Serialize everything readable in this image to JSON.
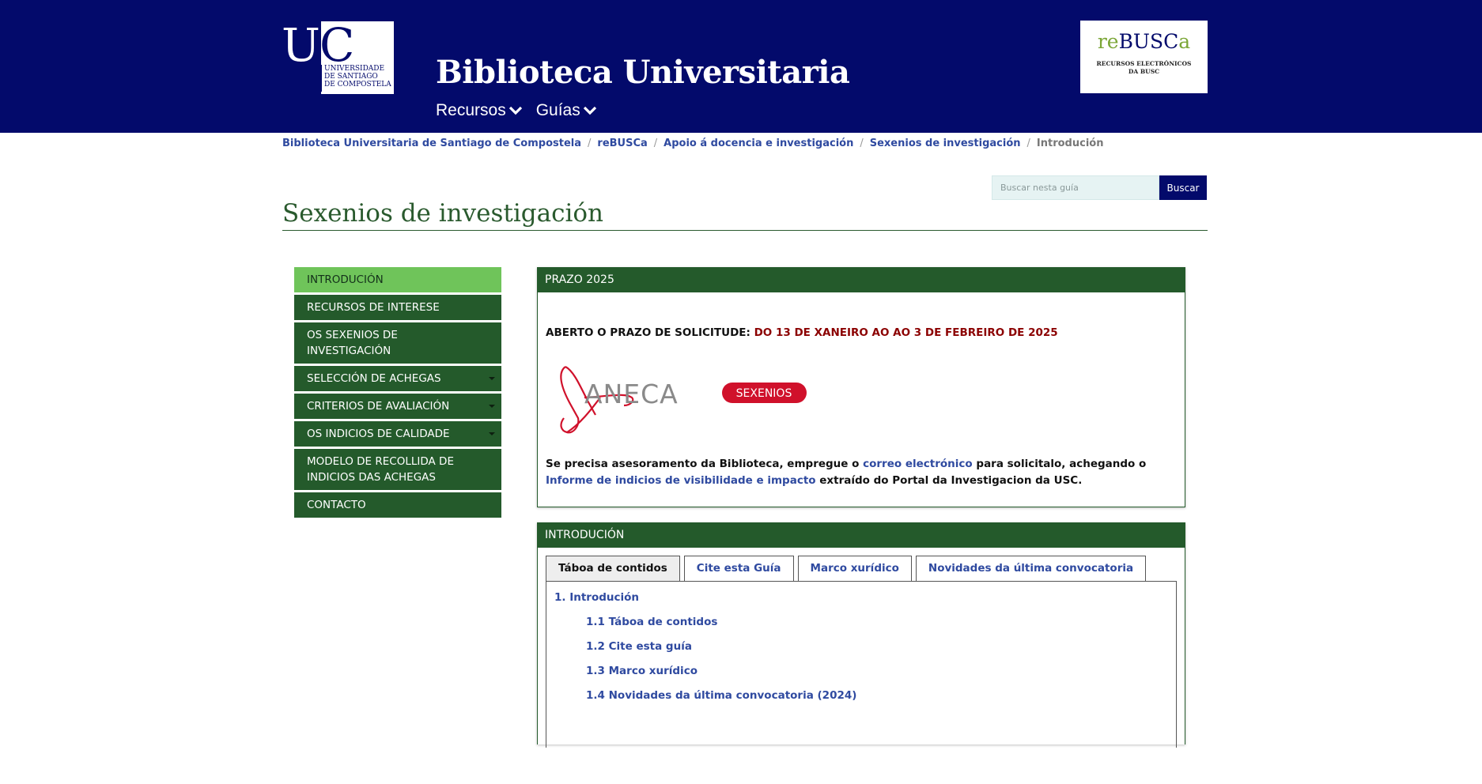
{
  "header": {
    "usc_logo": {
      "letters": "USC",
      "subtitle": "UNIVERSIDADE\nDE SANTIAGO\nDE COMPOSTELA"
    },
    "site_title": "Biblioteca Universitaria",
    "nav": [
      {
        "label": "Recursos"
      },
      {
        "label": "Guías"
      }
    ],
    "rebusca_logo": {
      "word_part1": "re",
      "word_part2": "BUSC",
      "word_part3": "a",
      "subtitle": "RECURSOS ELECTRÓNICOS\nDA BUSC"
    }
  },
  "breadcrumb": {
    "links": [
      "Biblioteca Universitaria de Santiago de Compostela",
      "reBUSCa",
      "Apoio á docencia e investigación",
      "Sexenios de investigación"
    ],
    "separator": "/",
    "current": "Introdución"
  },
  "search": {
    "placeholder": "Buscar nesta guía",
    "value": "",
    "button_label": "Buscar"
  },
  "page_title": "Sexenios de investigación",
  "sidenav": {
    "items": [
      {
        "label": "INTRODUCIÓN",
        "active": true,
        "has_submenu": false
      },
      {
        "label": "RECURSOS DE INTERESE",
        "active": false,
        "has_submenu": false
      },
      {
        "label": "OS SEXENIOS DE INVESTIGACIÓN",
        "active": false,
        "has_submenu": false
      },
      {
        "label": "SELECCIÓN DE ACHEGAS",
        "active": false,
        "has_submenu": true
      },
      {
        "label": "CRITERIOS DE AVALIACIÓN",
        "active": false,
        "has_submenu": true
      },
      {
        "label": "OS INDICIOS DE CALIDADE",
        "active": false,
        "has_submenu": true
      },
      {
        "label": "MODELO DE RECOLLIDA DE INDICIOS DAS ACHEGAS",
        "active": false,
        "has_submenu": false
      },
      {
        "label": "CONTACTO",
        "active": false,
        "has_submenu": false
      }
    ]
  },
  "prazo_box": {
    "heading": "PRAZO 2025",
    "announcement_prefix": "ABERTO O PRAZO DE SOLICITUDE: ",
    "announcement_dates": "DO 13 DE XANEIRO AO AO 3 DE FEBREIRO DE 2025",
    "logo": {
      "word": "ANECA",
      "badge": "SEXENIOS"
    },
    "help_text": {
      "part1": "Se precisa asesoramento da Biblioteca, empregue o ",
      "link1": "correo electrónico",
      "part2": " para solicitalo, achegando o ",
      "link2": "Informe de indicios de visibilidade e impacto",
      "part3": " extraído do Portal da Investigacion da USC."
    }
  },
  "intro_box": {
    "heading": "INTRODUCIÓN",
    "tabs": [
      {
        "label": "Táboa de contidos",
        "active": true
      },
      {
        "label": "Cite esta Guía",
        "active": false
      },
      {
        "label": "Marco xurídico",
        "active": false
      },
      {
        "label": "Novidades da última convocatoria",
        "active": false
      }
    ],
    "toc": [
      "1. Introdución",
      "1.1 Táboa de contidos",
      "1.2 Cite esta guía",
      "1.3 Marco xurídico",
      "1.4 Novidades da última convocatoria (2024)"
    ]
  },
  "colors": {
    "header_bg": "#030a6b",
    "primary_green": "#245a2b",
    "active_green": "#6fc45a",
    "link_blue": "#2f4aa0",
    "alert_red": "#8b0000",
    "aneca_red": "#d0112b"
  }
}
